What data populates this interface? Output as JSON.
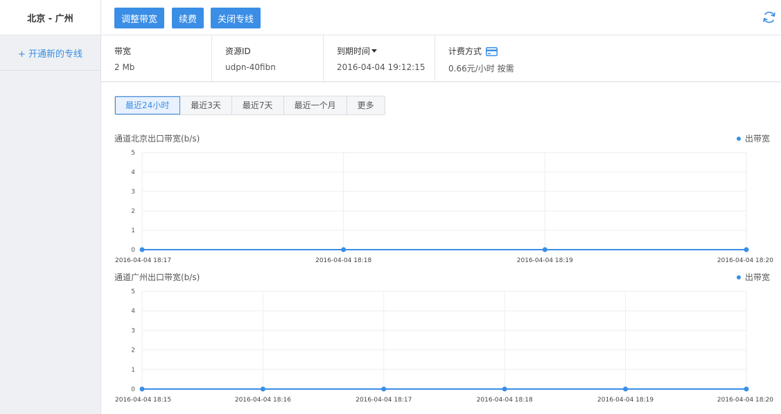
{
  "sidebar": {
    "title": "北京 - 广州",
    "new_link": "+ 开通新的专线"
  },
  "toolbar": {
    "adjust_label": "调整带宽",
    "renew_label": "续费",
    "close_label": "关闭专线",
    "refresh_icon": "refresh-icon"
  },
  "info": {
    "bandwidth": {
      "label": "带宽",
      "value": "2 Mb"
    },
    "resource": {
      "label": "资源ID",
      "value": "udpn-40fibn"
    },
    "expiry": {
      "label": "到期时间",
      "value": "2016-04-04 19:12:15"
    },
    "billing": {
      "label": "计费方式",
      "value": "0.66元/小时 按需",
      "icon": "credit-card-icon"
    }
  },
  "tabs": [
    {
      "label": "最近24小时",
      "active": true
    },
    {
      "label": "最近3天",
      "active": false
    },
    {
      "label": "最近7天",
      "active": false
    },
    {
      "label": "最近一个月",
      "active": false
    },
    {
      "label": "更多",
      "active": false
    }
  ],
  "colors": {
    "accent": "#3a8ee6",
    "grid": "#eeeeee",
    "sidebar_bg": "#eef0f3"
  },
  "chart_data": [
    {
      "type": "line",
      "title": "通道北京出口带宽(b/s)",
      "series": [
        {
          "name": "出带宽",
          "values": [
            0,
            0,
            0,
            0
          ]
        }
      ],
      "x": [
        "2016-04-04 18:17",
        "2016-04-04 18:18",
        "2016-04-04 18:19",
        "2016-04-04 18:20"
      ],
      "ylim": [
        0,
        5
      ],
      "yticks": [
        0,
        1,
        2,
        3,
        4,
        5
      ],
      "grid": true,
      "legend": "top-right"
    },
    {
      "type": "line",
      "title": "通道广州出口带宽(b/s)",
      "series": [
        {
          "name": "出带宽",
          "values": [
            0,
            0,
            0,
            0,
            0,
            0
          ]
        }
      ],
      "x": [
        "2016-04-04 18:15",
        "2016-04-04 18:16",
        "2016-04-04 18:17",
        "2016-04-04 18:18",
        "2016-04-04 18:19",
        "2016-04-04 18:20"
      ],
      "ylim": [
        0,
        5
      ],
      "yticks": [
        0,
        1,
        2,
        3,
        4,
        5
      ],
      "grid": true,
      "legend": "top-right"
    }
  ]
}
